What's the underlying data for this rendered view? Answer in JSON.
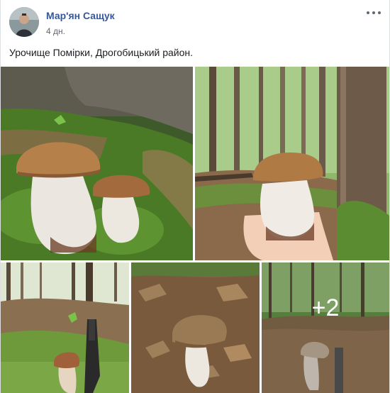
{
  "post": {
    "author": "Мар'ян Сащук",
    "time": "4 дн.",
    "caption": "Урочище Помірки, Дрогобицький район.",
    "more_photos": "+2"
  },
  "icons": {
    "avatar": "profile-photo",
    "more": "more-options-icon"
  }
}
